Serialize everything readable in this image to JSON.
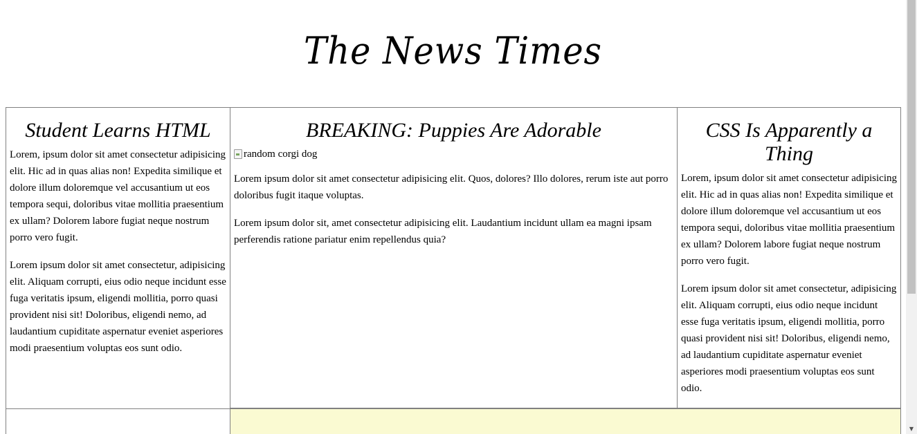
{
  "site_title": "The News Times",
  "columns": {
    "left": {
      "headline": "Student Learns HTML",
      "paragraphs": [
        "Lorem, ipsum dolor sit amet consectetur adipisicing elit. Hic ad in quas alias non! Expedita similique et dolore illum doloremque vel accusantium ut eos tempora sequi, doloribus vitae mollitia praesentium ex ullam? Dolorem labore fugiat neque nostrum porro vero fugit.",
        "Lorem ipsum dolor sit amet consectetur, adipisicing elit. Aliquam corrupti, eius odio neque incidunt esse fuga veritatis ipsum, eligendi mollitia, porro quasi provident nisi sit! Doloribus, eligendi nemo, ad laudantium cupiditate aspernatur eveniet asperiores modi praesentium voluptas eos sunt odio."
      ]
    },
    "middle": {
      "headline": "BREAKING: Puppies Are Adorable",
      "image_alt": "random corgi dog",
      "paragraphs": [
        "Lorem ipsum dolor sit amet consectetur adipisicing elit. Quos, dolores? Illo dolores, rerum iste aut porro doloribus fugit itaque voluptas.",
        "Lorem ipsum dolor sit, amet consectetur adipisicing elit. Laudantium incidunt ullam ea magni ipsam perferendis ratione pariatur enim repellendus quia?"
      ]
    },
    "right": {
      "headline": "CSS Is Apparently a Thing",
      "paragraphs": [
        "Lorem, ipsum dolor sit amet consectetur adipisicing elit. Hic ad in quas alias non! Expedita similique et dolore illum doloremque vel accusantium ut eos tempora sequi, doloribus vitae mollitia praesentium ex ullam? Dolorem labore fugiat neque nostrum porro vero fugit.",
        "Lorem ipsum dolor sit amet consectetur, adipisicing elit. Aliquam corrupti, eius odio neque incidunt esse fuga veritatis ipsum, eligendi mollitia, porro quasi provident nisi sit! Doloribus, eligendi nemo, ad laudantium cupiditate aspernatur eveniet asperiores modi praesentium voluptas eos sunt odio."
      ]
    }
  },
  "colors": {
    "border": "#808080",
    "highlight_cell": "#fafad2",
    "scrollbar_track": "#f1f1f1",
    "scrollbar_thumb": "#c1c1c1"
  },
  "icons": {
    "broken_image": "broken-image-icon",
    "scroll_up": "chevron-up-icon",
    "scroll_down": "chevron-down-icon"
  },
  "scroll_position": 0
}
